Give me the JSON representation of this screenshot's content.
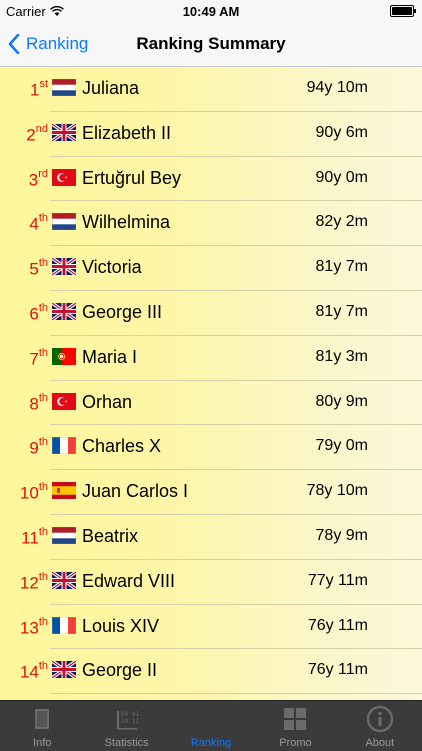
{
  "status_bar": {
    "carrier": "Carrier",
    "time": "10:49 AM"
  },
  "nav": {
    "back_label": "Ranking",
    "title": "Ranking Summary"
  },
  "rows": [
    {
      "rank": "1",
      "suffix": "st",
      "flag": "nl",
      "name": "Juliana",
      "age": "94y 10m"
    },
    {
      "rank": "2",
      "suffix": "nd",
      "flag": "uk",
      "name": "Elizabeth II",
      "age": "90y 6m"
    },
    {
      "rank": "3",
      "suffix": "rd",
      "flag": "tr",
      "name": "Ertuğrul Bey",
      "age": "90y 0m"
    },
    {
      "rank": "4",
      "suffix": "th",
      "flag": "nl",
      "name": "Wilhelmina",
      "age": "82y 2m"
    },
    {
      "rank": "5",
      "suffix": "th",
      "flag": "uk",
      "name": "Victoria",
      "age": "81y 7m"
    },
    {
      "rank": "6",
      "suffix": "th",
      "flag": "uk",
      "name": "George III",
      "age": "81y 7m"
    },
    {
      "rank": "7",
      "suffix": "th",
      "flag": "pt",
      "name": "Maria I",
      "age": "81y 3m"
    },
    {
      "rank": "8",
      "suffix": "th",
      "flag": "tr",
      "name": "Orhan",
      "age": "80y 9m"
    },
    {
      "rank": "9",
      "suffix": "th",
      "flag": "fr",
      "name": "Charles X",
      "age": "79y 0m"
    },
    {
      "rank": "10",
      "suffix": "th",
      "flag": "es",
      "name": "Juan Carlos I",
      "age": "78y 10m"
    },
    {
      "rank": "11",
      "suffix": "th",
      "flag": "nl",
      "name": "Beatrix",
      "age": "78y 9m"
    },
    {
      "rank": "12",
      "suffix": "th",
      "flag": "uk",
      "name": "Edward VIII",
      "age": "77y 11m"
    },
    {
      "rank": "13",
      "suffix": "th",
      "flag": "fr",
      "name": "Louis XIV",
      "age": "76y 11m"
    },
    {
      "rank": "14",
      "suffix": "th",
      "flag": "uk",
      "name": "George II",
      "age": "76y 11m"
    }
  ],
  "tabs": [
    {
      "label": "Info",
      "icon": "book-icon",
      "active": false
    },
    {
      "label": "Statistics",
      "icon": "chart-icon",
      "active": false
    },
    {
      "label": "Ranking",
      "icon": "ranking-icon",
      "active": true
    },
    {
      "label": "Promo",
      "icon": "grid-icon",
      "active": false
    },
    {
      "label": "About",
      "icon": "info-circle-icon",
      "active": false
    }
  ],
  "colors": {
    "accent": "#0a7aff",
    "rank_red": "#e0120b",
    "tab_bar": "#3b3b3b"
  }
}
